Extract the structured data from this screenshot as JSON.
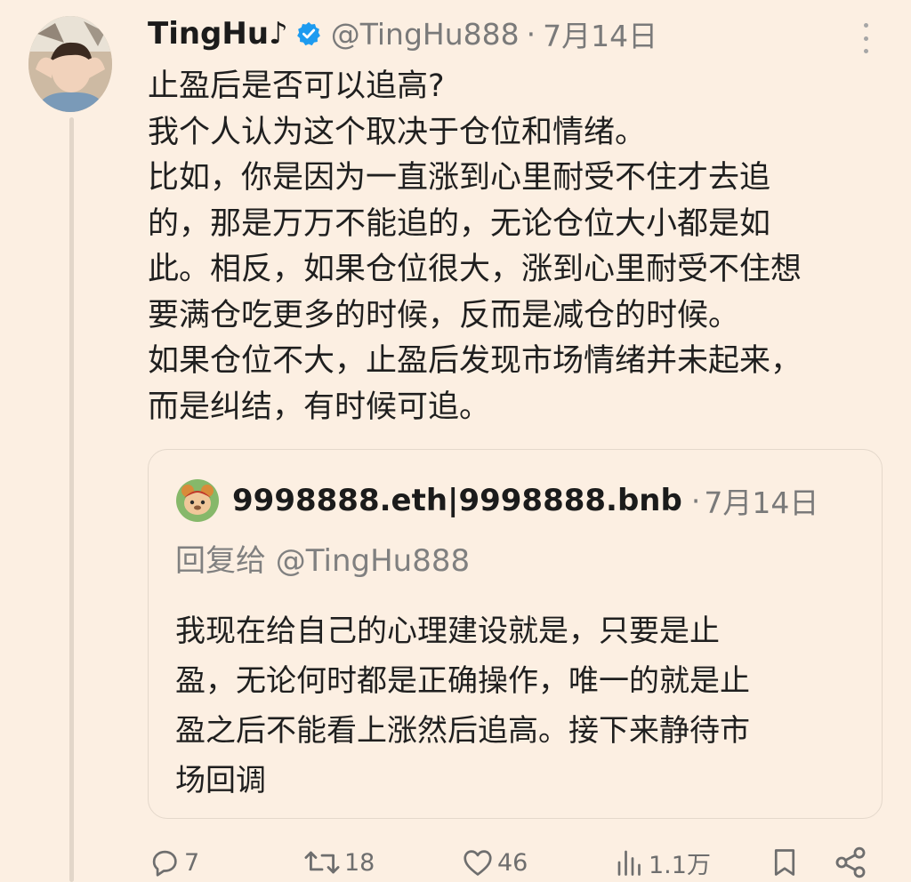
{
  "tweet": {
    "display_name": "TingHu♪",
    "handle": "@TingHu888",
    "separator": "·",
    "date": "7月14日",
    "body_lines": [
      "止盈后是否可以追高?",
      "我个人认为这个取决于仓位和情绪。",
      "比如，你是因为一直涨到心里耐受不住才去追",
      "的，那是万万不能追的，无论仓位大小都是如",
      "此。相反，如果仓位很大，涨到心里耐受不住想",
      "要满仓吃更多的时候，反而是减仓的时候。",
      "如果仓位不大，止盈后发现市场情绪并未起来，",
      "而是纠结，有时候可追。"
    ]
  },
  "quote": {
    "display_name": "9998888.eth|9998888.bnb",
    "separator": "·",
    "date": "7月14日",
    "reply_to": "回复给 @TingHu888",
    "body_lines": [
      "我现在给自己的心理建设就是，只要是止",
      "盈，无论何时都是正确操作，唯一的就是止",
      "盈之后不能看上涨然后追高。接下来静待市",
      "场回调"
    ]
  },
  "actions": {
    "reply": {
      "icon": "reply-icon",
      "count": "7"
    },
    "retweet": {
      "icon": "retweet-icon",
      "count": "18"
    },
    "like": {
      "icon": "heart-icon",
      "count": "46"
    },
    "views": {
      "icon": "views-icon",
      "count": "1.1万"
    },
    "bookmark": {
      "icon": "bookmark-icon"
    },
    "share": {
      "icon": "share-icon"
    }
  },
  "colors": {
    "background": "#fcefe2",
    "verified": "#1d9bf0",
    "muted": "#7a7a7a"
  }
}
